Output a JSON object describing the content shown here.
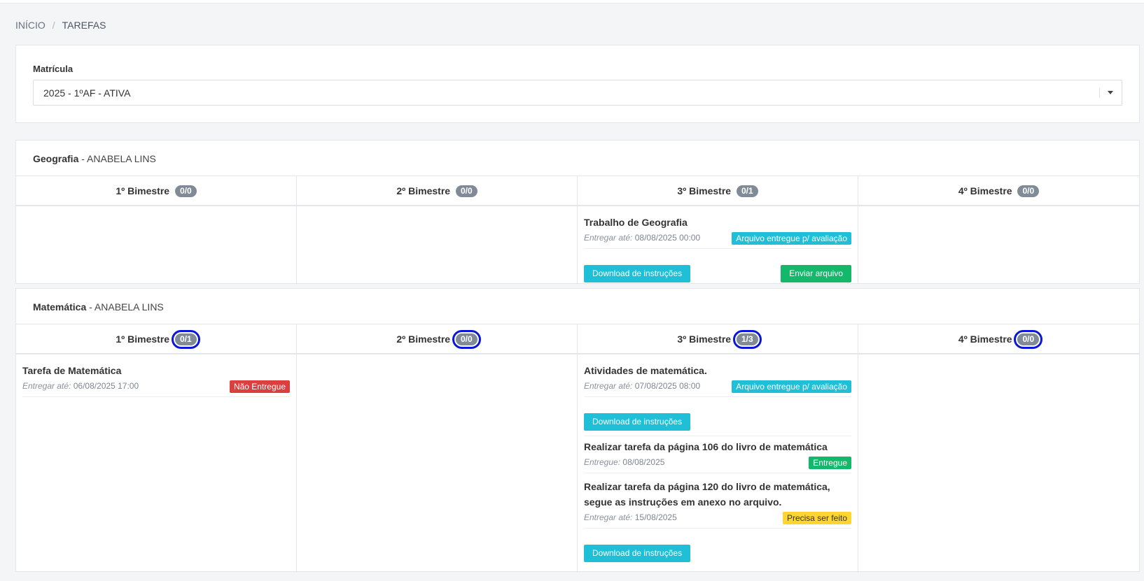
{
  "breadcrumb": {
    "home": "INÍCIO",
    "separator": "/",
    "current": "TAREFAS"
  },
  "enrollment": {
    "label": "Matrícula",
    "selected": "2025 - 1ºAF - ATIVA"
  },
  "subjects": [
    {
      "name": "Geografia",
      "teacher": "- ANABELA LINS",
      "terms": [
        {
          "label": "1º Bimestre",
          "count": "0/0"
        },
        {
          "label": "2º Bimestre",
          "count": "0/0"
        },
        {
          "label": "3º Bimestre",
          "count": "0/1"
        },
        {
          "label": "4º Bimestre",
          "count": "0/0"
        }
      ],
      "tasks": [
        {
          "title": "Trabalho de Geografia",
          "date_label": "Entregar até:",
          "date": "08/08/2025 00:00",
          "status": "Arquivo entregue p/ avaliação",
          "button_download": "Download de instruções",
          "button_send": "Enviar arquivo"
        }
      ]
    },
    {
      "name": "Matemática",
      "teacher": "- ANABELA LINS",
      "terms": [
        {
          "label": "1º Bimestre",
          "count": "0/1"
        },
        {
          "label": "2º Bimestre",
          "count": "0/0"
        },
        {
          "label": "3º Bimestre",
          "count": "1/3"
        },
        {
          "label": "4º Bimestre",
          "count": "0/0"
        }
      ],
      "tasks": [
        {
          "title": "Tarefa de Matemática",
          "date_label": "Entregar até:",
          "date": "06/08/2025 17:00",
          "status": "Não Entregue"
        },
        {
          "title": "Atividades de matemática.",
          "date_label": "Entregar até:",
          "date": "07/08/2025 08:00",
          "status": "Arquivo entregue p/ avaliação",
          "button_download": "Download de instruções"
        },
        {
          "title": "Realizar tarefa da página 106 do livro de matemática",
          "date_label": "Entregue:",
          "date": "08/08/2025",
          "status": "Entregue"
        },
        {
          "title_line1": "Realizar tarefa da página 120 do livro de matemática,",
          "title_line2": "segue as instruções em anexo no arquivo.",
          "date_label": "Entregar até:",
          "date": "15/08/2025",
          "status": "Precisa ser feito",
          "button_download": "Download de instruções"
        }
      ]
    }
  ],
  "colors": {
    "badge": "#808b97",
    "cyan": "#1fc0d7",
    "green": "#14b86a",
    "red": "#dc3f3f",
    "yellow": "#ffd530",
    "highlight": "#0a17d8"
  }
}
